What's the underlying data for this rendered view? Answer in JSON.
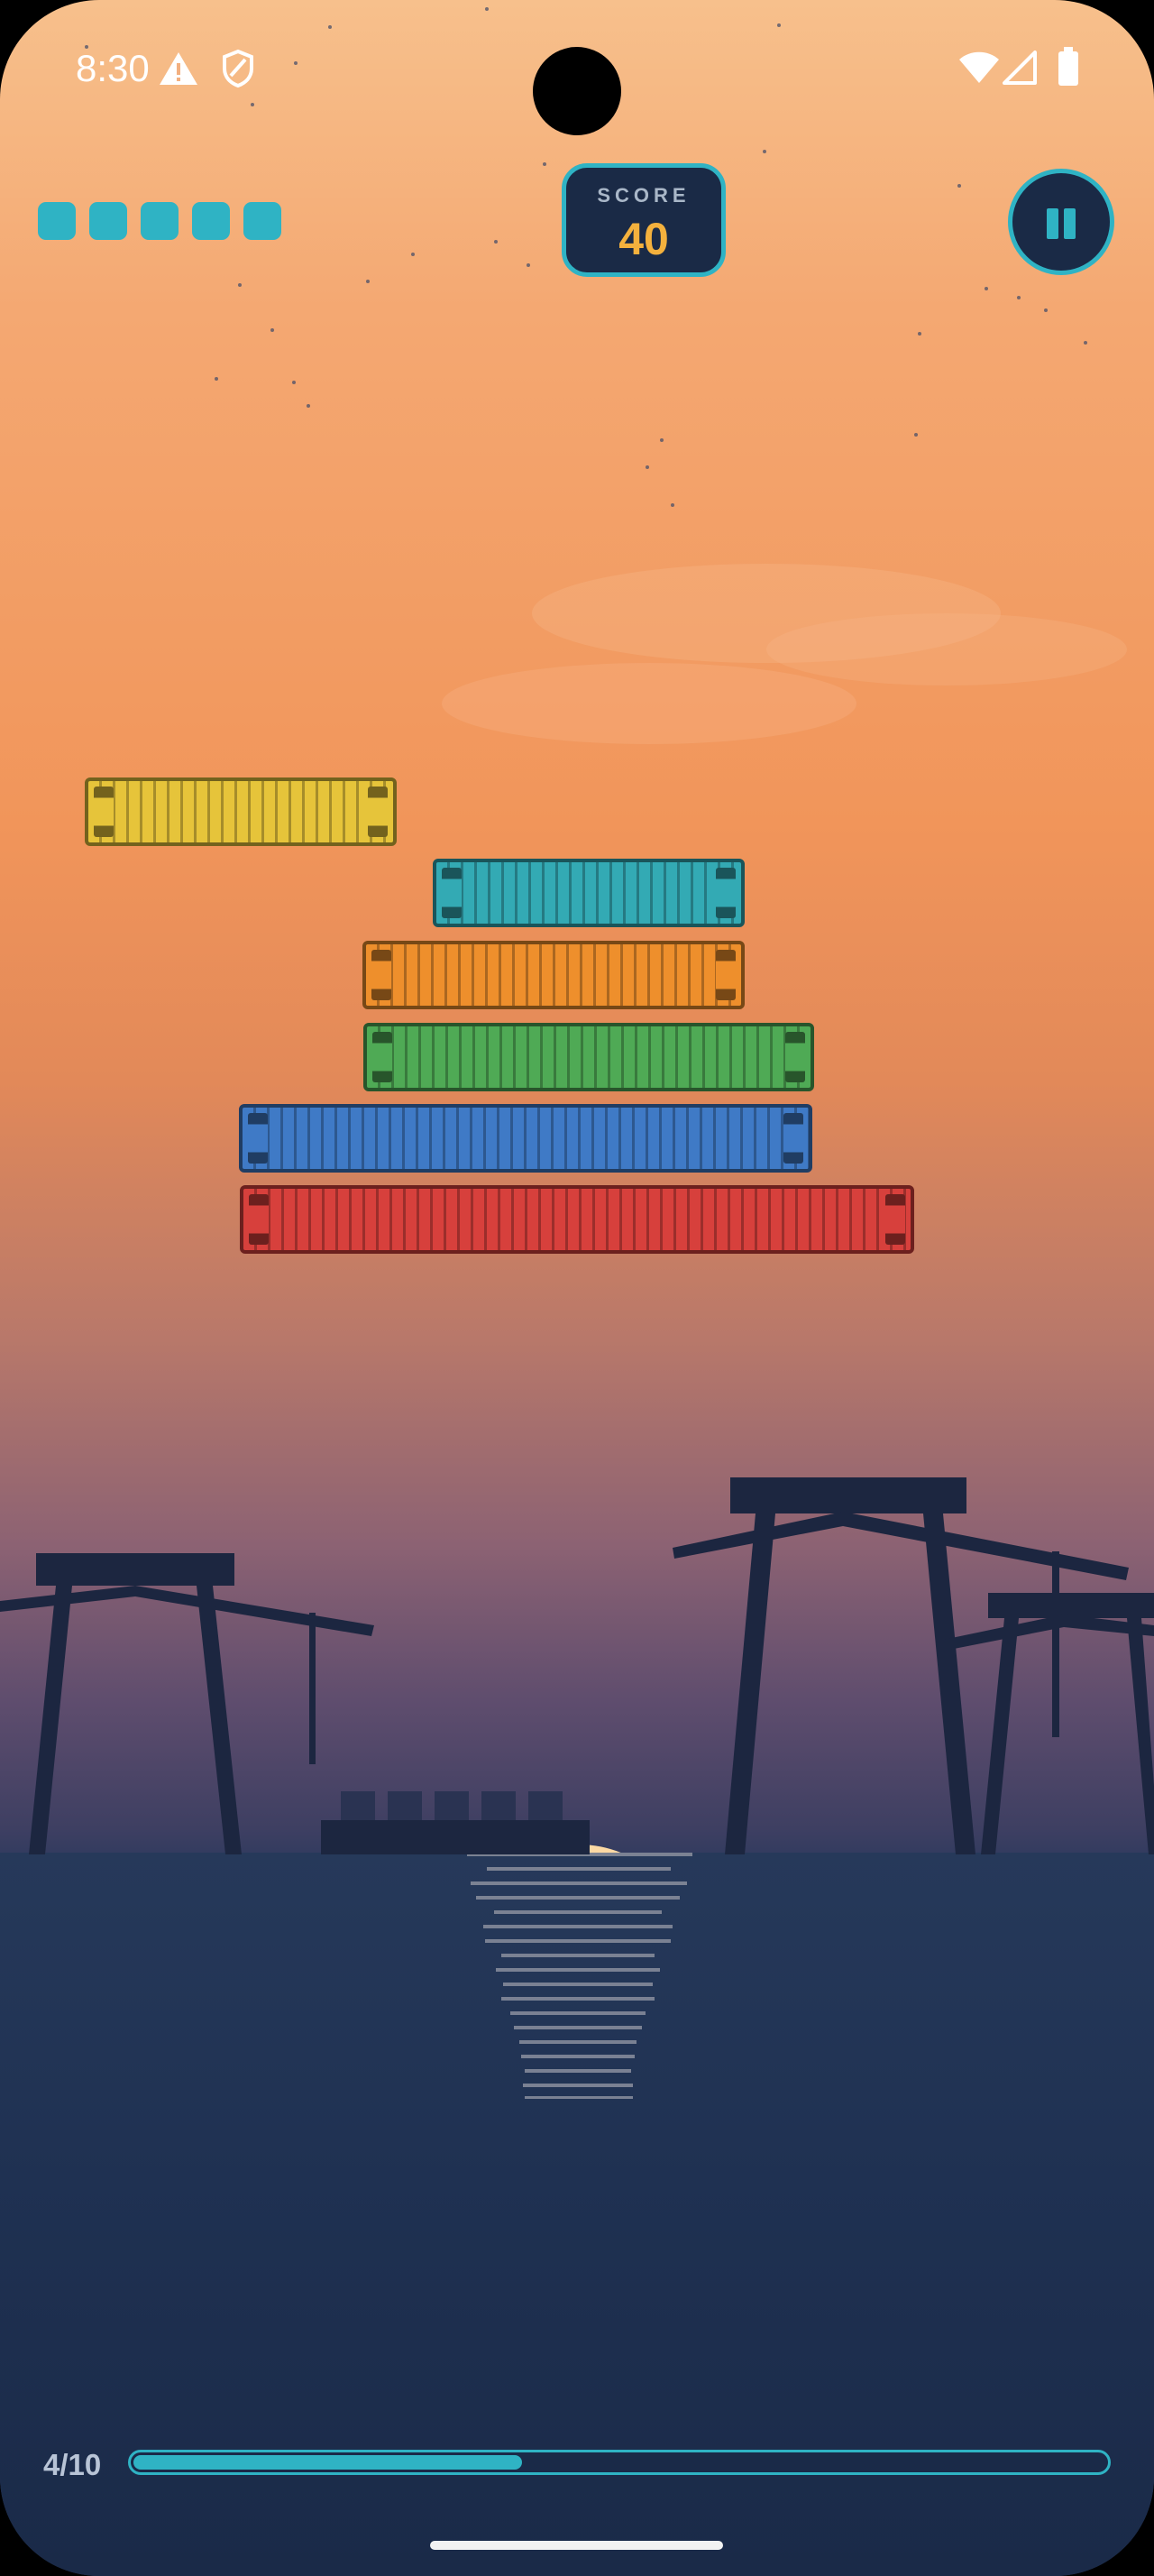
{
  "status_bar": {
    "time": "8:30",
    "left_icons": [
      "warning-icon",
      "shield-icon"
    ],
    "right_icons": [
      "wifi-icon",
      "cellular-signal-icon",
      "battery-icon"
    ]
  },
  "hud": {
    "lives": 5,
    "score_label": "SCORE",
    "score_value": "40",
    "pause_icon": "pause-icon"
  },
  "scene": {
    "description_elements": [
      "sky",
      "stars",
      "clouds",
      "sun",
      "sea",
      "sun-reflection",
      "cargo-ship",
      "gantry-cranes"
    ]
  },
  "containers": {
    "swinging": {
      "color": "yellow"
    },
    "stack": [
      {
        "color": "red"
      },
      {
        "color": "blue"
      },
      {
        "color": "green"
      },
      {
        "color": "orange"
      },
      {
        "color": "teal"
      }
    ]
  },
  "colors": {
    "accent": "#2fb3c4",
    "score": "#f4b13d",
    "panel": "#1a2a46",
    "yellow": "#e6c43a",
    "teal": "#33aab4",
    "orange": "#ee8f2c",
    "green": "#4faa55",
    "blue": "#3f7ac6",
    "red": "#d7403c",
    "silhouette": "#1c2640"
  },
  "progress": {
    "label": "4/10",
    "value": 4,
    "max": 10
  }
}
